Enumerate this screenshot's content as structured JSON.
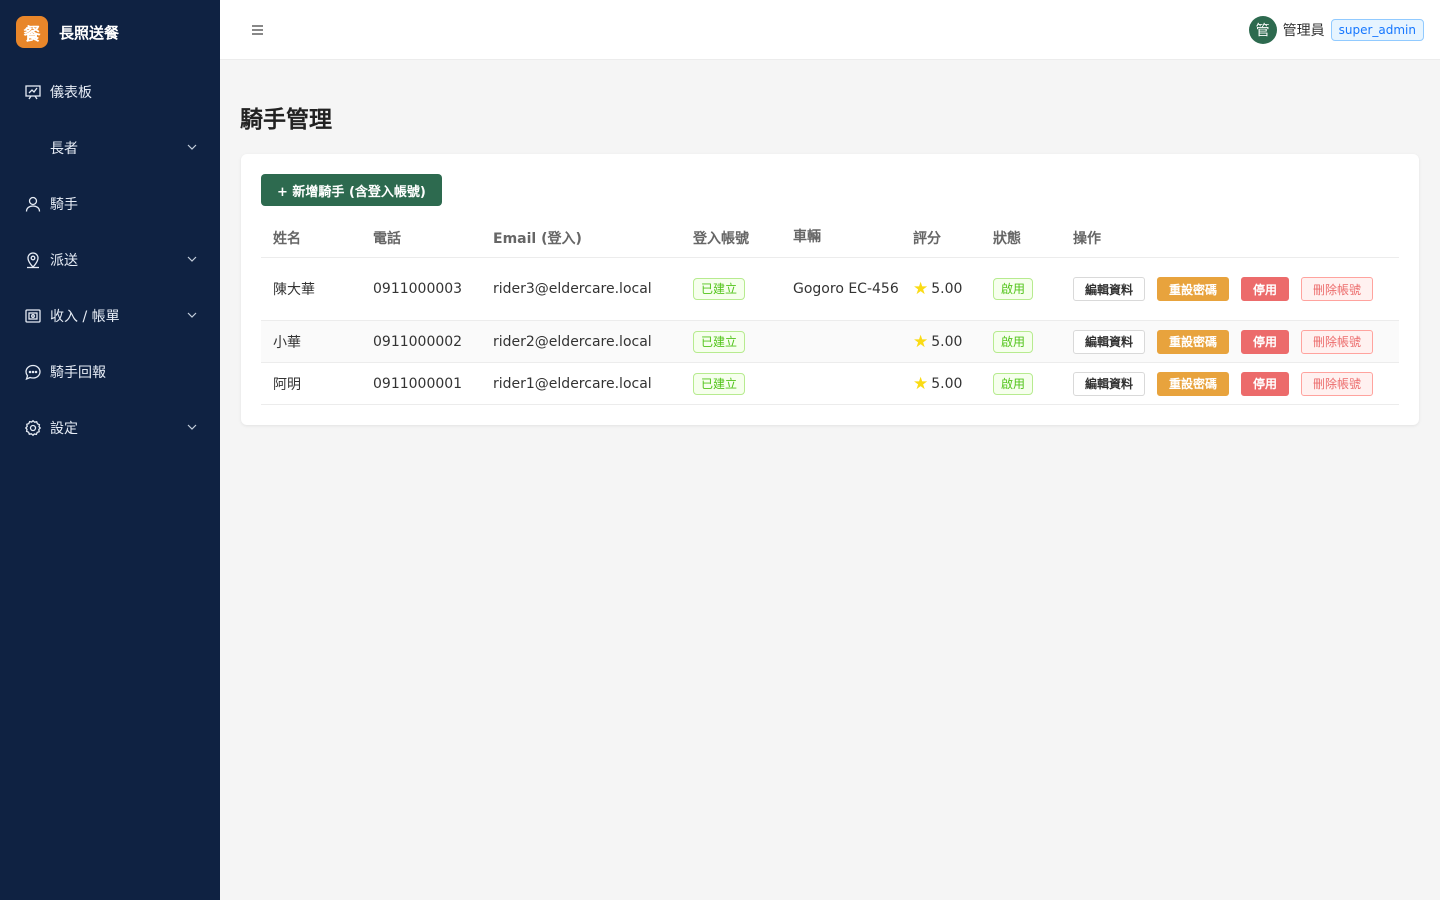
{
  "brand": {
    "logo": "餐",
    "title": "長照送餐"
  },
  "sidebar": {
    "items": [
      {
        "label": "儀表板",
        "icon": "dashboard-icon"
      },
      {
        "label": "長者",
        "icon": "",
        "has_submenu": true
      },
      {
        "label": "騎手",
        "icon": "user-icon"
      },
      {
        "label": "派送",
        "icon": "location-icon",
        "has_submenu": true
      },
      {
        "label": "收入 / 帳單",
        "icon": "wallet-icon",
        "has_submenu": true
      },
      {
        "label": "騎手回報",
        "icon": "chat-icon"
      },
      {
        "label": "設定",
        "icon": "gear-icon",
        "has_submenu": true
      }
    ]
  },
  "header": {
    "avatar_text": "管",
    "user_name": "管理員",
    "role": "super_admin"
  },
  "page": {
    "title": "騎手管理",
    "add_button": "+ 新增騎手 (含登入帳號)"
  },
  "table": {
    "columns": [
      "姓名",
      "電話",
      "Email (登入)",
      "登入帳號",
      "車輛",
      "評分",
      "狀態",
      "操作"
    ],
    "rows": [
      {
        "name": "陳大華",
        "phone": "0911000003",
        "email": "rider3@eldercare.local",
        "account": "已建立",
        "vehicle": "Gogoro EC-456",
        "rating": "5.00",
        "status": "啟用"
      },
      {
        "name": "小華",
        "phone": "0911000002",
        "email": "rider2@eldercare.local",
        "account": "已建立",
        "vehicle": "",
        "rating": "5.00",
        "status": "啟用"
      },
      {
        "name": "阿明",
        "phone": "0911000001",
        "email": "rider1@eldercare.local",
        "account": "已建立",
        "vehicle": "",
        "rating": "5.00",
        "status": "啟用"
      }
    ],
    "actions": {
      "edit": "編輯資料",
      "reset": "重設密碼",
      "disable": "停用",
      "delete": "刪除帳號"
    }
  },
  "colors": {
    "sidebar_bg": "#0f2242",
    "brand_accent": "#e8862a",
    "primary": "#2d6a4f",
    "warning": "#e8a33d",
    "danger": "#ec6b6b",
    "success": "#52c41a"
  }
}
